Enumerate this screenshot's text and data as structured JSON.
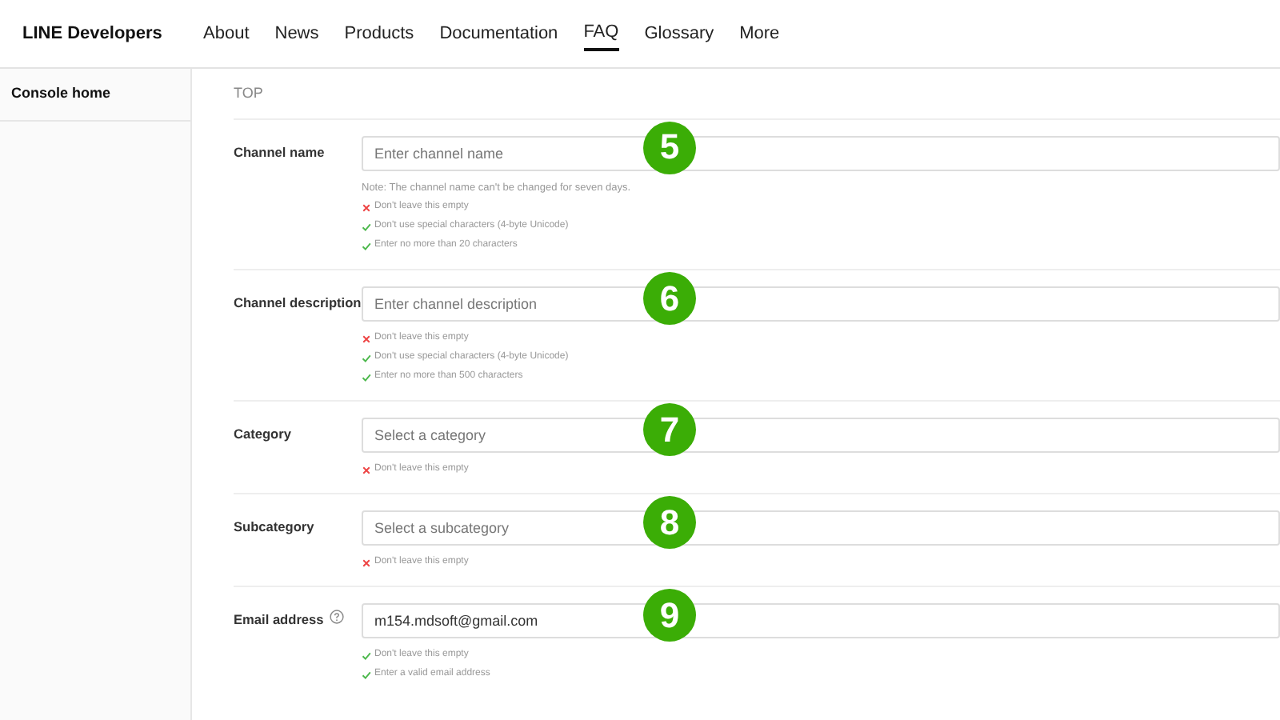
{
  "header": {
    "logo": "LINE Developers",
    "nav": [
      {
        "label": "About",
        "selected": false
      },
      {
        "label": "News",
        "selected": false
      },
      {
        "label": "Products",
        "selected": false
      },
      {
        "label": "Documentation",
        "selected": false
      },
      {
        "label": "FAQ",
        "selected": true
      },
      {
        "label": "Glossary",
        "selected": false
      },
      {
        "label": "More",
        "selected": false
      }
    ]
  },
  "sidebar": {
    "items": [
      "Console home"
    ]
  },
  "breadcrumb": "TOP",
  "fields": [
    {
      "label": "Channel name",
      "help": false,
      "placeholder": "Enter channel name",
      "note": "Note: The channel name can't be changed for seven days.",
      "badge": "5",
      "rules": [
        {
          "text": "Don't leave this empty",
          "met": false
        },
        {
          "text": "Don't use special characters (4-byte Unicode)",
          "met": true
        },
        {
          "text": "Enter no more than 20 characters",
          "met": true
        }
      ]
    },
    {
      "label": "Channel description",
      "help": false,
      "placeholder": "Enter channel description",
      "badge": "6",
      "rules": [
        {
          "text": "Don't leave this empty",
          "met": false
        },
        {
          "text": "Don't use special characters (4-byte Unicode)",
          "met": true
        },
        {
          "text": "Enter no more than 500 characters",
          "met": true
        }
      ]
    },
    {
      "label": "Category",
      "help": false,
      "placeholder": "Select a category",
      "badge": "7",
      "rules": [
        {
          "text": "Don't leave this empty",
          "met": false
        }
      ]
    },
    {
      "label": "Subcategory",
      "help": false,
      "placeholder": "Select a subcategory",
      "badge": "8",
      "rules": [
        {
          "text": "Don't leave this empty",
          "met": false
        }
      ]
    },
    {
      "label": "Email address",
      "help": true,
      "value": "m154.mdsoft@gmail.com",
      "badge": "9",
      "rules": [
        {
          "text": "Don't leave this empty",
          "met": true
        },
        {
          "text": "Enter a valid email address",
          "met": true
        }
      ]
    }
  ]
}
